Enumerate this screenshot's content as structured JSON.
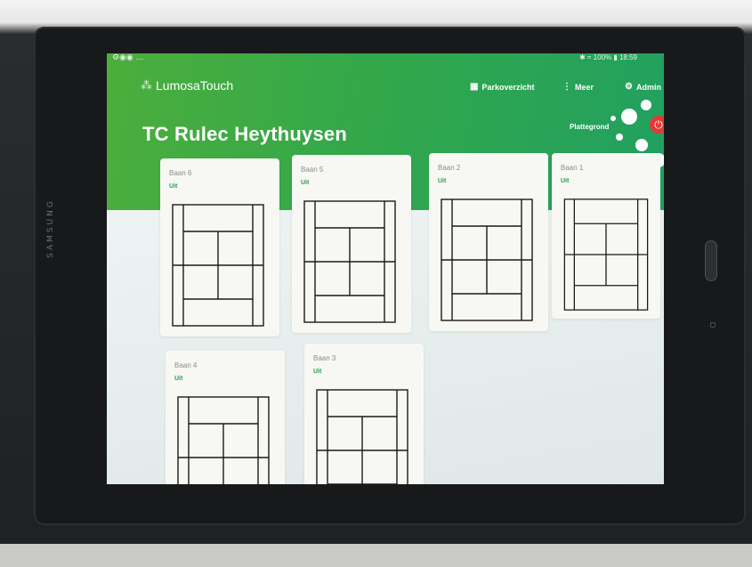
{
  "device": {
    "brand": "SAMSUNG"
  },
  "status_bar": {
    "left_icons": "⚙◉◉ ...",
    "right_text": "✱ ≈ 100% ▮ 18:59"
  },
  "app": {
    "logo_text": "LumosaTouch",
    "nav": [
      {
        "label": "Parkoverzicht",
        "icon": "grid-icon"
      },
      {
        "label": "Meer",
        "icon": "dots-icon"
      },
      {
        "label": "Admin",
        "icon": "gear-icon"
      }
    ],
    "club_name": "TC Rulec Heythuysen",
    "floorplan_label": "Plattegrond",
    "power_icon": "power-icon",
    "accent_green": "#3aab48",
    "status_green": "#2f9e4d",
    "power_red": "#e53935"
  },
  "courts": [
    {
      "name": "Baan 6",
      "status": "Uit"
    },
    {
      "name": "Baan 5",
      "status": "Uit"
    },
    {
      "name": "Baan 2",
      "status": "Uit"
    },
    {
      "name": "Baan 1",
      "status": "Uit"
    },
    {
      "name": "Baan 4",
      "status": "Uit"
    },
    {
      "name": "Baan 3",
      "status": "Uit"
    }
  ]
}
